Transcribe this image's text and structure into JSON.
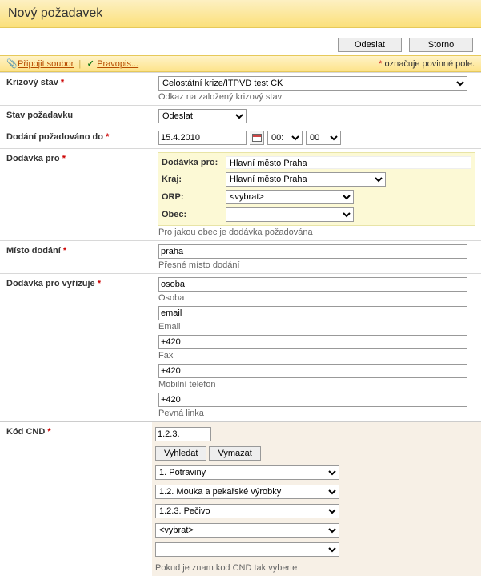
{
  "title": "Nový požadavek",
  "buttons": {
    "send": "Odeslat",
    "cancel": "Storno"
  },
  "toolbar": {
    "attach": "Připojit soubor",
    "spell": "Pravopis...",
    "req_note_star": "*",
    "req_note": "označuje povinné pole."
  },
  "rows": {
    "crisis": {
      "label": "Krizový stav",
      "value": "Celostátní krize/ITPVD test CK",
      "hint": "Odkaz na založený krizový stav"
    },
    "status": {
      "label": "Stav požadavku",
      "value": "Odeslat"
    },
    "due": {
      "label": "Dodání požadováno do",
      "date": "15.4.2010",
      "hour": "00:",
      "min": "00"
    },
    "delfor": {
      "label": "Dodávka pro",
      "f_delfor": "Dodávka pro:",
      "f_delfor_val": "Hlavní město Praha",
      "f_region": "Kraj:",
      "f_region_val": "Hlavní město Praha",
      "f_orp": "ORP:",
      "f_orp_val": "<vybrat>",
      "f_obec": "Obec:",
      "f_obec_val": "",
      "hint": "Pro jakou obec je dodávka požadována"
    },
    "place": {
      "label": "Místo dodání",
      "value": "praha",
      "hint": "Přesné místo dodání"
    },
    "handler": {
      "label": "Dodávka pro vyřizuje",
      "person_val": "osoba",
      "person_lbl": "Osoba",
      "email_val": "email",
      "email_lbl": "Email",
      "fax_val": "+420",
      "fax_lbl": "Fax",
      "mob_val": "+420",
      "mob_lbl": "Mobilní telefon",
      "land_val": "+420",
      "land_lbl": "Pevná linka"
    },
    "cnd": {
      "label": "Kód CND",
      "code": "1.2.3.",
      "btn_search": "Vyhledat",
      "btn_clear": "Vymazat",
      "sel1": "1. Potraviny",
      "sel2": "1.2. Mouka a pekařské výrobky",
      "sel3": "1.2.3. Pečivo",
      "sel4": "<vybrat>",
      "sel5": "",
      "hint": "Pokud je znam kod CND tak vyberte"
    }
  }
}
